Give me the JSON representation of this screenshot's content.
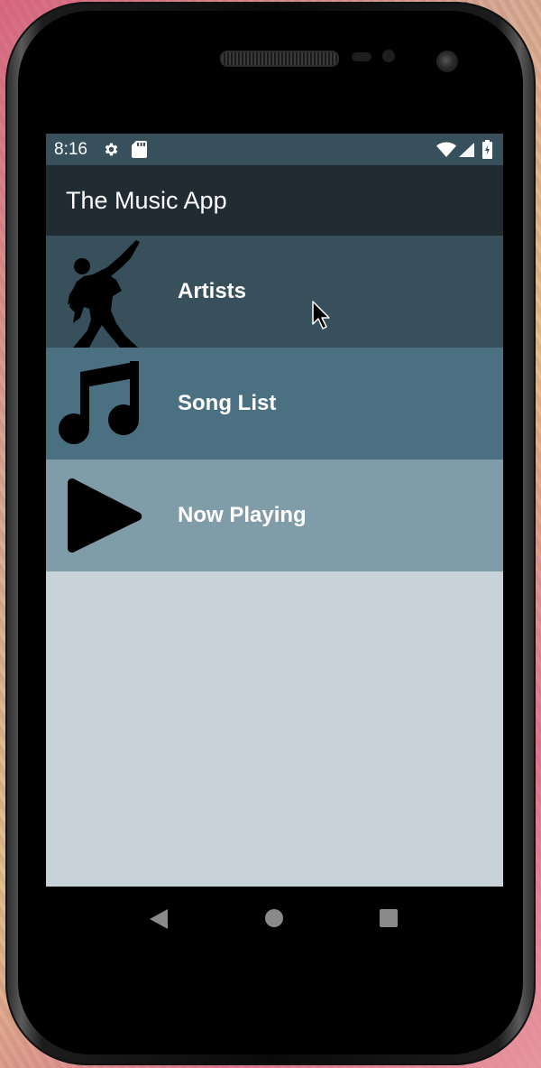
{
  "status_bar": {
    "time": "8:16",
    "left_icons": [
      "settings-icon",
      "sd-card-icon"
    ],
    "right_icons": [
      "wifi-icon",
      "signal-icon",
      "battery-icon"
    ]
  },
  "app_bar": {
    "title": "The Music App"
  },
  "menu": {
    "items": [
      {
        "label": "Artists",
        "icon": "dancer-silhouette-icon",
        "color": "#37505c"
      },
      {
        "label": "Song List",
        "icon": "music-note-icon",
        "color": "#4b7082"
      },
      {
        "label": "Now Playing",
        "icon": "play-icon",
        "color": "#819ca9"
      }
    ]
  },
  "content_background": "#c7d3d9",
  "nav_bar": {
    "buttons": [
      "back-icon",
      "home-icon",
      "recents-icon"
    ]
  }
}
